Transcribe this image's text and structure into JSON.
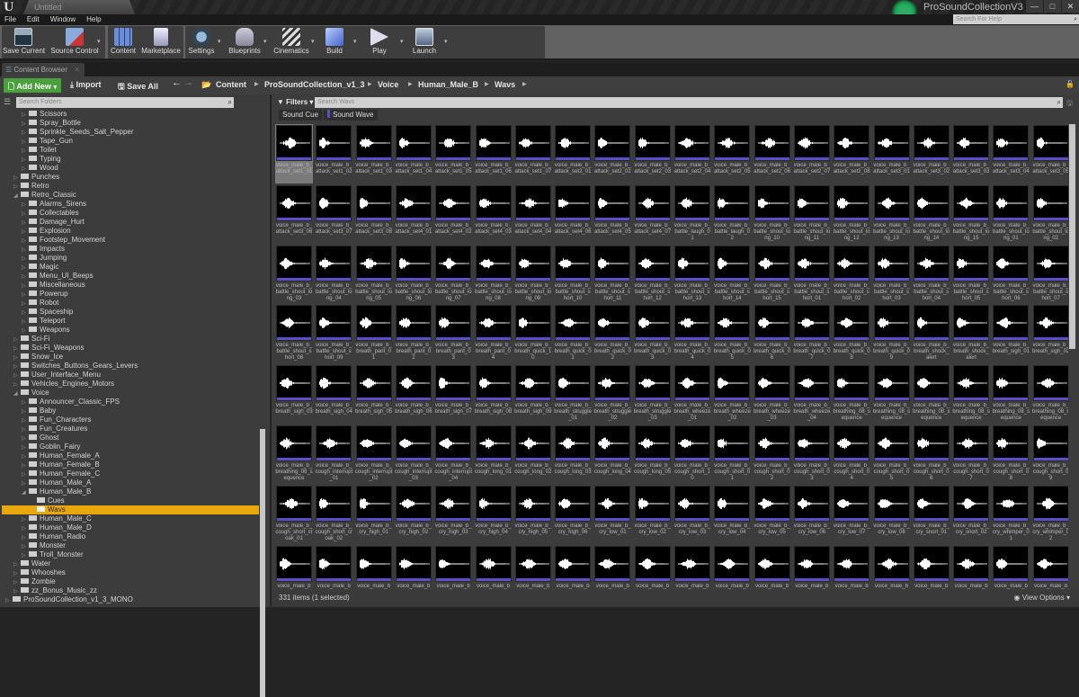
{
  "window": {
    "document_tab": "Untitled",
    "project_name": "ProSoundCollectionV3",
    "controls": [
      "minimize",
      "maximize",
      "close"
    ]
  },
  "menu": [
    "File",
    "Edit",
    "Window",
    "Help"
  ],
  "help_search": {
    "placeholder": "Search For Help"
  },
  "toolbar": [
    {
      "label": "Save Current",
      "icon": "floppy-disk-icon",
      "dropdown": false
    },
    {
      "label": "Source Control",
      "icon": "source-control-icon",
      "dropdown": true
    },
    {
      "label": "Content",
      "icon": "content-grid-icon",
      "dropdown": false
    },
    {
      "label": "Marketplace",
      "icon": "marketplace-bag-icon",
      "dropdown": false
    },
    {
      "label": "Settings",
      "icon": "settings-gear-icon",
      "dropdown": true
    },
    {
      "label": "Blueprints",
      "icon": "gamepad-icon",
      "dropdown": true
    },
    {
      "label": "Cinematics",
      "icon": "clapperboard-icon",
      "dropdown": true
    },
    {
      "label": "Build",
      "icon": "build-cubes-icon",
      "dropdown": true
    },
    {
      "label": "Play",
      "icon": "play-icon",
      "dropdown": true
    },
    {
      "label": "Launch",
      "icon": "launch-monitor-icon",
      "dropdown": true
    }
  ],
  "content_browser": {
    "tab_label": "Content Browser",
    "add_new": "Add New",
    "import": "Import",
    "save_all": "Save All",
    "breadcrumb": [
      "Content",
      "ProSoundCollection_v1_3",
      "Voice",
      "Human_Male_B",
      "Wavs"
    ],
    "folder_search_placeholder": "Search Folders",
    "filters_label": "Filters",
    "asset_search_placeholder": "Search Wavs",
    "filter_chips": [
      {
        "label": "Sound Cue",
        "color": null
      },
      {
        "label": "Sound Wave",
        "color": "#5b4fc7"
      }
    ],
    "status": "331 items (1 selected)",
    "view_options": "View Options"
  },
  "folder_tree": [
    {
      "label": "Scissors",
      "depth": 2,
      "expanded": false
    },
    {
      "label": "Spray_Bottle",
      "depth": 2,
      "expanded": false
    },
    {
      "label": "Sprinkle_Seeds_Salt_Pepper",
      "depth": 2,
      "expanded": false
    },
    {
      "label": "Tape_Gun",
      "depth": 2,
      "expanded": false
    },
    {
      "label": "Toilet",
      "depth": 2,
      "expanded": false
    },
    {
      "label": "Typing",
      "depth": 2,
      "expanded": false
    },
    {
      "label": "Wood",
      "depth": 2,
      "expanded": false
    },
    {
      "label": "Punches",
      "depth": 1,
      "expanded": false
    },
    {
      "label": "Retro",
      "depth": 1,
      "expanded": false
    },
    {
      "label": "Retro_Classic",
      "depth": 1,
      "expanded": true
    },
    {
      "label": "Alarms_Sirens",
      "depth": 2,
      "expanded": false
    },
    {
      "label": "Collectables",
      "depth": 2,
      "expanded": false
    },
    {
      "label": "Damage_Hurt",
      "depth": 2,
      "expanded": false
    },
    {
      "label": "Explosion",
      "depth": 2,
      "expanded": false
    },
    {
      "label": "Footstep_Movement",
      "depth": 2,
      "expanded": false
    },
    {
      "label": "Impacts",
      "depth": 2,
      "expanded": false
    },
    {
      "label": "Jumping",
      "depth": 2,
      "expanded": false
    },
    {
      "label": "Magic",
      "depth": 2,
      "expanded": false
    },
    {
      "label": "Menu_UI_Beeps",
      "depth": 2,
      "expanded": false
    },
    {
      "label": "Miscellaneous",
      "depth": 2,
      "expanded": false
    },
    {
      "label": "Powerup",
      "depth": 2,
      "expanded": false
    },
    {
      "label": "Robot",
      "depth": 2,
      "expanded": false
    },
    {
      "label": "Spaceship",
      "depth": 2,
      "expanded": false
    },
    {
      "label": "Teleport",
      "depth": 2,
      "expanded": false
    },
    {
      "label": "Weapons",
      "depth": 2,
      "expanded": false
    },
    {
      "label": "Sci-Fi",
      "depth": 1,
      "expanded": false
    },
    {
      "label": "Sci-Fi_Weapons",
      "depth": 1,
      "expanded": false
    },
    {
      "label": "Snow_Ice",
      "depth": 1,
      "expanded": false
    },
    {
      "label": "Switches_Buttons_Gears_Levers",
      "depth": 1,
      "expanded": false
    },
    {
      "label": "User_Interface_Menu",
      "depth": 1,
      "expanded": false
    },
    {
      "label": "Vehicles_Engines_Motors",
      "depth": 1,
      "expanded": false
    },
    {
      "label": "Voice",
      "depth": 1,
      "expanded": true
    },
    {
      "label": "Announcer_Classic_FPS",
      "depth": 2,
      "expanded": false
    },
    {
      "label": "Baby",
      "depth": 2,
      "expanded": false
    },
    {
      "label": "Fun_Characters",
      "depth": 2,
      "expanded": false
    },
    {
      "label": "Fun_Creatures",
      "depth": 2,
      "expanded": false
    },
    {
      "label": "Ghost",
      "depth": 2,
      "expanded": false
    },
    {
      "label": "Goblin_Fairy",
      "depth": 2,
      "expanded": false
    },
    {
      "label": "Human_Female_A",
      "depth": 2,
      "expanded": false
    },
    {
      "label": "Human_Female_B",
      "depth": 2,
      "expanded": false
    },
    {
      "label": "Human_Female_C",
      "depth": 2,
      "expanded": false
    },
    {
      "label": "Human_Male_A",
      "depth": 2,
      "expanded": false
    },
    {
      "label": "Human_Male_B",
      "depth": 2,
      "expanded": true
    },
    {
      "label": "Cues",
      "depth": 3,
      "leaf": true
    },
    {
      "label": "Wavs",
      "depth": 3,
      "leaf": true,
      "selected": true
    },
    {
      "label": "Human_Male_C",
      "depth": 2,
      "expanded": false
    },
    {
      "label": "Human_Male_D",
      "depth": 2,
      "expanded": false
    },
    {
      "label": "Human_Radio",
      "depth": 2,
      "expanded": false
    },
    {
      "label": "Monster",
      "depth": 2,
      "expanded": false
    },
    {
      "label": "Troll_Monster",
      "depth": 2,
      "expanded": false
    },
    {
      "label": "Water",
      "depth": 1,
      "expanded": false
    },
    {
      "label": "Whooshes",
      "depth": 1,
      "expanded": false
    },
    {
      "label": "Zombie",
      "depth": 1,
      "expanded": false
    },
    {
      "label": "zz_Bonus_Music_zz",
      "depth": 1,
      "expanded": false
    },
    {
      "label": "ProSoundCollection_v1_3_MONO",
      "depth": 0,
      "expanded": false
    }
  ],
  "assets": [
    "voice_male_b_attack_set1_01",
    "voice_male_b_attack_set1_02",
    "voice_male_b_attack_set1_03",
    "voice_male_b_attack_set1_04",
    "voice_male_b_attack_set1_05",
    "voice_male_b_attack_set1_06",
    "voice_male_b_attack_set1_07",
    "voice_male_b_attack_set2_01",
    "voice_male_b_attack_set2_02",
    "voice_male_b_attack_set2_03",
    "voice_male_b_attack_set2_04",
    "voice_male_b_attack_set2_05",
    "voice_male_b_attack_set2_06",
    "voice_male_b_attack_set2_07",
    "voice_male_b_attack_set2_08",
    "voice_male_b_attack_set3_01",
    "voice_male_b_attack_set3_02",
    "voice_male_b_attack_set3_03",
    "voice_male_b_attack_set3_04",
    "voice_male_b_attack_set3_05",
    "voice_male_b_attack_set3_06",
    "voice_male_b_attack_set3_07",
    "voice_male_b_attack_set3_08",
    "voice_male_b_attack_set4_01",
    "voice_male_b_attack_set4_02",
    "voice_male_b_attack_set4_03",
    "voice_male_b_attack_set4_04",
    "voice_male_b_attack_set4_06",
    "voice_male_b_attack_set4_05",
    "voice_male_b_attack_set4_07",
    "voice_male_b_battle_laugh_01",
    "voice_male_b_battle_laugh_02",
    "voice_male_b_battle_shout_long_10",
    "voice_male_b_battle_shout_long_11",
    "voice_male_b_battle_shout_long_12",
    "voice_male_b_battle_shout_long_13",
    "voice_male_b_battle_shout_long_14",
    "voice_male_b_battle_shout_long_15",
    "voice_male_b_battle_shout_long_01",
    "voice_male_b_battle_shout_long_02",
    "voice_male_b_battle_shout_long_03",
    "voice_male_b_battle_shout_long_04",
    "voice_male_b_battle_shout_long_05",
    "voice_male_b_battle_shout_long_06",
    "voice_male_b_battle_shout_long_07",
    "voice_male_b_battle_shout_long_08",
    "voice_male_b_battle_shout_long_09",
    "voice_male_b_battle_shout_short_10",
    "voice_male_b_battle_shout_short_11",
    "voice_male_b_battle_shout_short_12",
    "voice_male_b_battle_shout_short_13",
    "voice_male_b_battle_shout_short_14",
    "voice_male_b_battle_shout_short_15",
    "voice_male_b_battle_shout_short_01",
    "voice_male_b_battle_shout_short_02",
    "voice_male_b_battle_shout_short_03",
    "voice_male_b_battle_shout_short_04",
    "voice_male_b_battle_shout_short_05",
    "voice_male_b_battle_shout_short_06",
    "voice_male_b_battle_shout_short_07",
    "voice_male_b_battle_shout_short_08",
    "voice_male_b_battle_shout_short_09",
    "voice_male_b_breath_pant_01",
    "voice_male_b_breath_pant_02",
    "voice_male_b_breath_pant_03",
    "voice_male_b_breath_pant_04",
    "voice_male_b_breath_quick_10",
    "voice_male_b_breath_quick_01",
    "voice_male_b_breath_quick_02",
    "voice_male_b_breath_quick_03",
    "voice_male_b_breath_quick_04",
    "voice_male_b_breath_quick_05",
    "voice_male_b_breath_quick_06",
    "voice_male_b_breath_quick_07",
    "voice_male_b_breath_quick_08",
    "voice_male_b_breath_quick_09",
    "voice_male_b_breath_shock_alert",
    "voice_male_b_breath_shock_alert",
    "voice_male_b_breath_sigh_01",
    "voice_male_b_breath_sigh_02",
    "voice_male_b_breath_sigh_03",
    "voice_male_b_breath_sigh_04",
    "voice_male_b_breath_sigh_05",
    "voice_male_b_breath_sigh_06",
    "voice_male_b_breath_sigh_07",
    "voice_male_b_breath_sigh_08",
    "voice_male_b_breath_sigh_09",
    "voice_male_b_breath_struggle_01",
    "voice_male_b_breath_struggle_02",
    "voice_male_b_breath_struggle_03",
    "voice_male_b_breath_wheeze_01",
    "voice_male_b_breath_wheeze_02",
    "voice_male_b_breath_wheeze_03",
    "voice_male_b_breath_wheeze_04",
    "voice_male_b_breathing_08_sequence",
    "voice_male_b_breathing_08_sequence",
    "voice_male_b_breathing_08_sequence",
    "voice_male_b_breathing_08_sequence",
    "voice_male_b_breathing_08_sequence",
    "voice_male_b_breathing_08_sequence",
    "voice_male_b_breathing_08_sequence",
    "voice_male_b_cough_interrupt_01",
    "voice_male_b_cough_interrupt_02",
    "voice_male_b_cough_interrupt_03",
    "voice_male_b_cough_interrupt_04",
    "voice_male_b_cough_long_01",
    "voice_male_b_cough_long_02",
    "voice_male_b_cough_long_03",
    "voice_male_b_cough_long_04",
    "voice_male_b_cough_long_05",
    "voice_male_b_cough_short_10",
    "voice_male_b_cough_short_01",
    "voice_male_b_cough_short_02",
    "voice_male_b_cough_short_03",
    "voice_male_b_cough_short_04",
    "voice_male_b_cough_short_05",
    "voice_male_b_cough_short_06",
    "voice_male_b_cough_short_07",
    "voice_male_b_cough_short_08",
    "voice_male_b_cough_short_09",
    "voice_male_b_cough_short_croak_01",
    "voice_male_b_cough_short_croak_02",
    "voice_male_b_cry_high_01",
    "voice_male_b_cry_high_02",
    "voice_male_b_cry_high_03",
    "voice_male_b_cry_high_04",
    "voice_male_b_cry_high_05",
    "voice_male_b_cry_high_06",
    "voice_male_b_cry_low_01",
    "voice_male_b_cry_low_02",
    "voice_male_b_cry_low_03",
    "voice_male_b_cry_low_04",
    "voice_male_b_cry_low_05",
    "voice_male_b_cry_low_06",
    "voice_male_b_cry_low_07",
    "voice_male_b_cry_low_08",
    "voice_male_b_cry_snort_01",
    "voice_male_b_cry_snort_02",
    "voice_male_b_cry_whimper_01",
    "voice_male_b_cry_whimper_02",
    "voice_male_b",
    "voice_male_b",
    "voice_male_b",
    "voice_male_b",
    "voice_male_b",
    "voice_male_b",
    "voice_male_b",
    "voice_male_b",
    "voice_male_b",
    "voice_male_b",
    "voice_male_b",
    "voice_male_b",
    "voice_male_b",
    "voice_male_b",
    "voice_male_b",
    "voice_male_b",
    "voice_male_b",
    "voice_male_b",
    "voice_male_b",
    "voice_male_b"
  ],
  "selected_asset_index": 0
}
